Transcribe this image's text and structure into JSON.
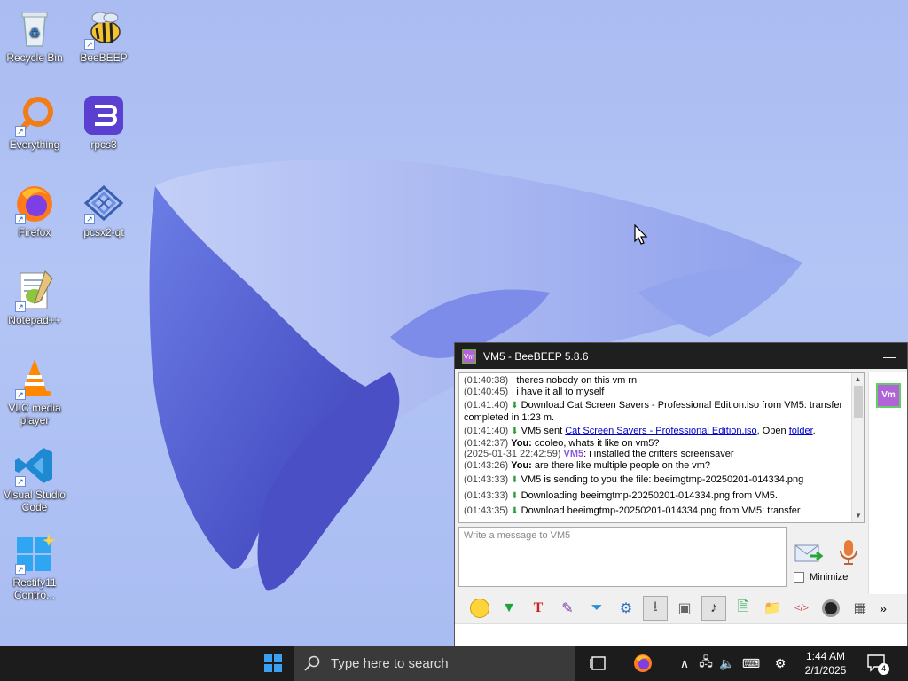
{
  "desktop": {
    "icons": [
      {
        "label": "Recycle Bin",
        "icon": "recycle-bin-icon"
      },
      {
        "label": "BeeBEEP",
        "icon": "beebeep-icon"
      },
      {
        "label": "Everything",
        "icon": "everything-search-icon"
      },
      {
        "label": "rpcs3",
        "icon": "rpcs3-icon"
      },
      {
        "label": "Firefox",
        "icon": "firefox-icon"
      },
      {
        "label": "pcsx2-qt",
        "icon": "pcsx2-icon"
      },
      {
        "label": "Notepad++",
        "icon": "notepadpp-icon"
      },
      {
        "label": "VLC media player",
        "icon": "vlc-icon"
      },
      {
        "label": "Visual Studio Code",
        "icon": "vscode-icon"
      },
      {
        "label": "Rectify11 Contro...",
        "icon": "rectify11-icon"
      }
    ]
  },
  "window": {
    "title": "VM5 - BeeBEEP 5.8.6",
    "app_icon_text": "Vm",
    "minimize_glyph": "—",
    "avatar_text": "Vm",
    "chat": [
      {
        "ts": "(01:40:38)",
        "text": "theres nobody on this vm rn"
      },
      {
        "ts": "(01:40:45)",
        "text": "i have it all to myself"
      },
      {
        "ts": "(01:41:40)",
        "text": "Download Cat Screen Savers - Professional Edition.iso from VM5: transfer completed in 1:23 m."
      },
      {
        "ts": "(01:41:40)",
        "pre": "VM5 sent ",
        "link": "Cat Screen Savers - Professional Edition.iso",
        "mid": ", Open ",
        "link2": "folder",
        "post": "."
      },
      {
        "ts": "(01:42:37)",
        "who": "You:",
        "text": "cooleo, whats it like on vm5?"
      },
      {
        "ts": "(2025-01-31 22:42:59)",
        "who": "VM5",
        "text": ": i installed the critters screensaver"
      },
      {
        "ts": "(01:43:26)",
        "who": "You:",
        "text": "are there like multiple people on the vm?"
      },
      {
        "ts": "(01:43:33)",
        "text": "VM5 is sending to you the file: beeimgtmp-20250201-014334.png"
      },
      {
        "ts": "(01:43:33)",
        "text": "Downloading beeimgtmp-20250201-014334.png from VM5."
      },
      {
        "ts": "(01:43:35)",
        "text": "Download beeimgtmp-20250201-014334.png from VM5: transfer"
      }
    ],
    "message_placeholder": "Write a message to VM5",
    "minimize_label": "Minimize",
    "more_glyph": "»"
  },
  "taskbar": {
    "search_placeholder": "Type here to search",
    "time": "1:44 AM",
    "date": "2/1/2025",
    "notification_count": "4",
    "tray_up_glyph": "∧"
  },
  "colors": {
    "desktop_bg": "#aabcf1",
    "taskbar_bg": "#1c1c1c",
    "accent_blue": "#0078d4",
    "vm_purple": "#b064d8"
  }
}
